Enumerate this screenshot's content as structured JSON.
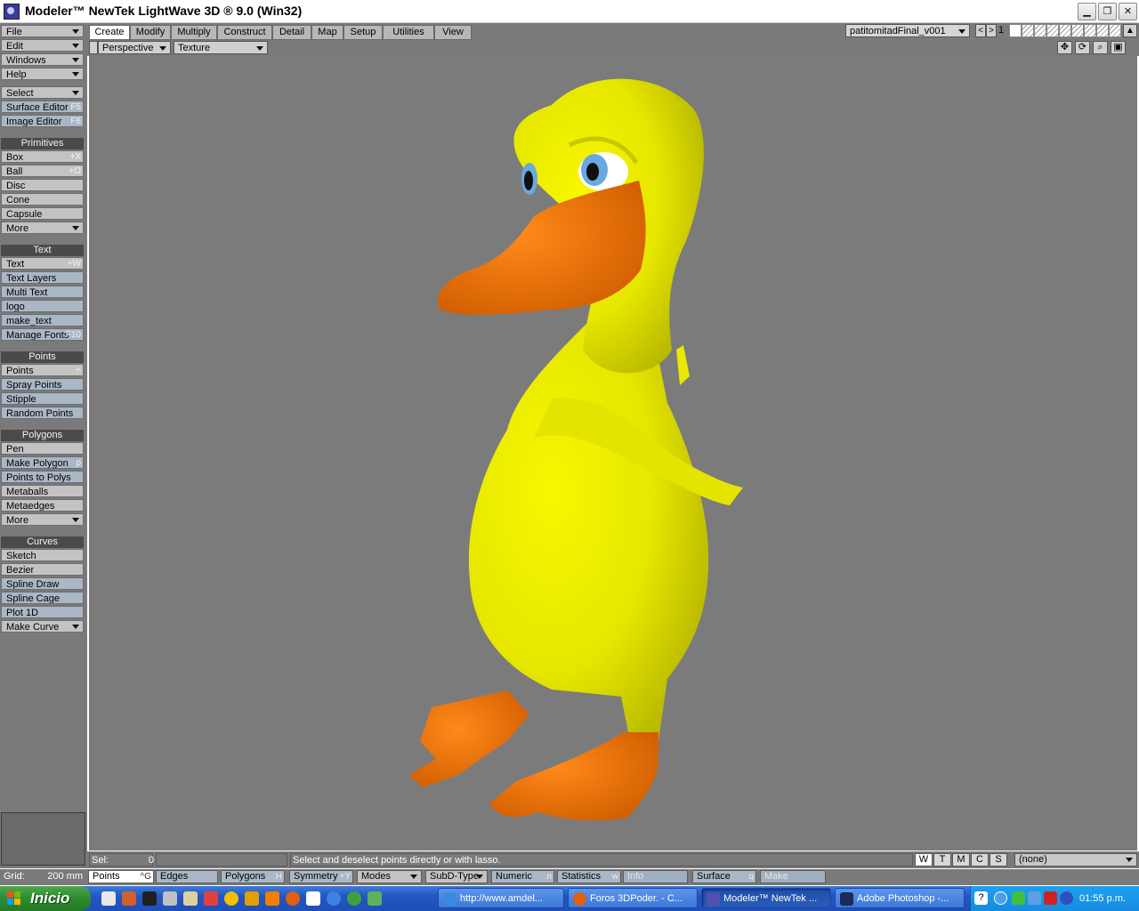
{
  "window": {
    "title": "Modeler™ NewTek LightWave 3D ® 9.0 (Win32)",
    "minimize": "▁",
    "restore": "❐",
    "close": "✕"
  },
  "left_panel": {
    "top_menus": [
      {
        "label": "File"
      },
      {
        "label": "Edit"
      },
      {
        "label": "Windows"
      },
      {
        "label": "Help"
      }
    ],
    "select": "Select",
    "surface_editor": {
      "label": "Surface Editor",
      "shortcut": "F5"
    },
    "image_editor": {
      "label": "Image Editor",
      "shortcut": "F6"
    },
    "primitives_header": "Primitives",
    "primitives": [
      {
        "label": "Box",
        "shortcut": "+X"
      },
      {
        "label": "Ball",
        "shortcut": "+O"
      },
      {
        "label": "Disc",
        "shortcut": ""
      },
      {
        "label": "Cone",
        "shortcut": ""
      },
      {
        "label": "Capsule",
        "shortcut": ""
      },
      {
        "label": "More",
        "shortcut": ""
      }
    ],
    "text_header": "Text",
    "text_tools": [
      {
        "label": "Text",
        "shortcut": "+W"
      },
      {
        "label": "Text Layers",
        "shortcut": ""
      },
      {
        "label": "Multi Text",
        "shortcut": ""
      },
      {
        "label": "logo",
        "shortcut": ""
      },
      {
        "label": "make_text",
        "shortcut": ""
      },
      {
        "label": "Manage Fonts",
        "shortcut": "F10"
      }
    ],
    "points_header": "Points",
    "points_tools": [
      {
        "label": "Points",
        "shortcut": "+"
      },
      {
        "label": "Spray Points",
        "shortcut": ""
      },
      {
        "label": "Stipple",
        "shortcut": ""
      },
      {
        "label": "Random Points",
        "shortcut": ""
      }
    ],
    "polygons_header": "Polygons",
    "polygon_tools": [
      {
        "label": "Pen",
        "shortcut": ""
      },
      {
        "label": "Make Polygon",
        "shortcut": "p"
      },
      {
        "label": "Points to Polys",
        "shortcut": ""
      },
      {
        "label": "Metaballs",
        "shortcut": ""
      },
      {
        "label": "Metaedges",
        "shortcut": ""
      },
      {
        "label": "More",
        "shortcut": ""
      }
    ],
    "curves_header": "Curves",
    "curve_tools": [
      {
        "label": "Sketch",
        "shortcut": ""
      },
      {
        "label": "Bezier",
        "shortcut": ""
      },
      {
        "label": "Spline Draw",
        "shortcut": ""
      },
      {
        "label": "Spline Cage",
        "shortcut": ""
      },
      {
        "label": "Plot 1D",
        "shortcut": ""
      },
      {
        "label": "Make Curve",
        "shortcut": ""
      }
    ]
  },
  "tabs": [
    {
      "label": "Create",
      "active": true
    },
    {
      "label": "Modify"
    },
    {
      "label": "Multiply"
    },
    {
      "label": "Construct"
    },
    {
      "label": "Detail"
    },
    {
      "label": "Map"
    },
    {
      "label": "Setup"
    },
    {
      "label": "Utilities"
    },
    {
      "label": "View"
    }
  ],
  "object": {
    "name": "patitomitadFinal_v001",
    "prev": "<",
    "next": ">",
    "layer": "1"
  },
  "viewport": {
    "view": "Perspective",
    "shading": "Texture",
    "icons": [
      "move-view-icon",
      "rotate-view-icon",
      "zoom-view-icon",
      "maximize-view-icon"
    ],
    "colors": {
      "background": "#7b7b7b",
      "body": "#f0f000",
      "beak": "#f07800",
      "eye": "#6aa8e0"
    }
  },
  "status": {
    "sel_label": "Sel:",
    "sel_value": "0",
    "message": "Select and deselect points directly or with lasso.",
    "wtmcs": [
      "W",
      "T",
      "M",
      "C",
      "S"
    ],
    "surface": "(none)"
  },
  "modebar": {
    "grid_label": "Grid:",
    "grid_value": "200 mm",
    "points": {
      "label": "Points",
      "shortcut": "^G"
    },
    "edges": {
      "label": "Edges",
      "shortcut": ""
    },
    "polygons": {
      "label": "Polygons",
      "shortcut": "H"
    },
    "symmetry": {
      "label": "Symmetry",
      "shortcut": "+Y"
    },
    "modes": "Modes",
    "subd_type": "SubD-Type",
    "numeric": {
      "label": "Numeric",
      "shortcut": "n"
    },
    "statistics": {
      "label": "Statistics",
      "shortcut": "w"
    },
    "info": "Info",
    "surface": {
      "label": "Surface",
      "shortcut": "q"
    },
    "make": "Make"
  },
  "taskbar": {
    "start": "Inicio",
    "tasks": [
      {
        "label": "http://www.amdel...",
        "icon": "ie-icon"
      },
      {
        "label": "Foros 3DPoder. - C...",
        "icon": "firefox-icon"
      },
      {
        "label": "Modeler™ NewTek ...",
        "icon": "lightwave-icon",
        "active": true
      },
      {
        "label": "Adobe Photoshop -...",
        "icon": "photoshop-icon"
      }
    ],
    "clock": "01:55 p.m."
  }
}
